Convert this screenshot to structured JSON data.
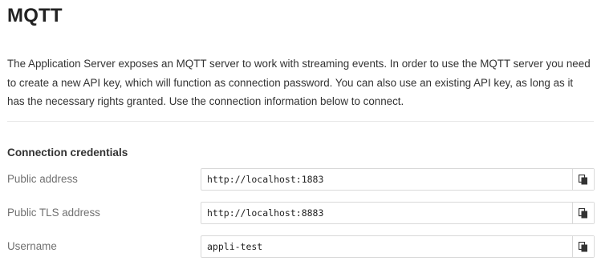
{
  "page": {
    "title": "MQTT",
    "description": "The Application Server exposes an MQTT server to work with streaming events. In order to use the MQTT server you need to create a new API key, which will function as connection password. You can also use an existing API key, as long as it has the necessary rights granted. Use the connection information below to connect."
  },
  "connection": {
    "heading": "Connection credentials",
    "fields": [
      {
        "label": "Public address",
        "value": "http://localhost:1883",
        "icon": "copy-icon"
      },
      {
        "label": "Public TLS address",
        "value": "http://localhost:8883",
        "icon": "copy-icon"
      },
      {
        "label": "Username",
        "value": "appli-test",
        "icon": "copy-icon"
      }
    ]
  },
  "colors": {
    "text": "#222222",
    "label": "#707070",
    "border": "#d9d9d9",
    "divider": "#e6e6e6"
  }
}
